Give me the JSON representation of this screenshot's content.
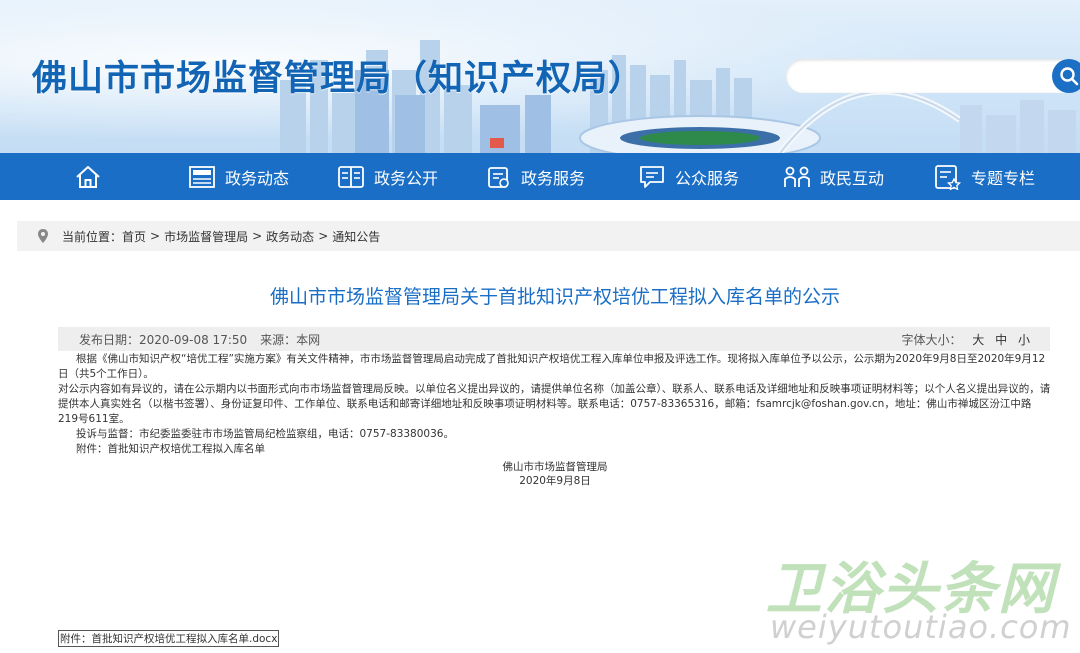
{
  "header": {
    "site_title": "佛山市市场监督管理局（知识产权局）",
    "search": {
      "value": "",
      "placeholder": ""
    }
  },
  "nav": {
    "home_icon": "home-icon",
    "items": [
      {
        "label": "政务动态",
        "icon": "news-icon"
      },
      {
        "label": "政务公开",
        "icon": "book-icon"
      },
      {
        "label": "政务服务",
        "icon": "service-icon"
      },
      {
        "label": "公众服务",
        "icon": "message-icon"
      },
      {
        "label": "政民互动",
        "icon": "people-icon"
      },
      {
        "label": "专题专栏",
        "icon": "topic-icon"
      }
    ]
  },
  "breadcrumb": {
    "prefix": "当前位置：",
    "items": [
      "首页",
      "市场监督管理局",
      "政务动态",
      "通知公告"
    ],
    "separator": ">"
  },
  "article": {
    "title": "佛山市市场监督管理局关于首批知识产权培优工程拟入库名单的公示",
    "publish_date": "发布日期：2020-09-08 17:50",
    "source": "来源：本网",
    "font_size_label": "字体大小：",
    "font_sizes": [
      "大",
      "中",
      "小"
    ],
    "paragraphs": [
      "根据《佛山市知识产权“培优工程”实施方案》有关文件精神，市市场监督管理局启动完成了首批知识产权培优工程入库单位申报及评选工作。现将拟入库单位予以公示，公示期为2020年9月8日至2020年9月12日（共5个工作日）。",
      "对公示内容如有异议的，请在公示期内以书面形式向市市场监督管理局反映。以单位名义提出异议的，请提供单位名称（加盖公章）、联系人、联系电话及详细地址和反映事项证明材料等；以个人名义提出异议的，请提供本人真实姓名（以楷书签署）、身份证复印件、工作单位、联系电话和邮寄详细地址和反映事项证明材料等。联系电话：0757-83365316，邮箱：fsamrcjk@foshan.gov.cn，地址：佛山市禅城区汾江中路219号611室。",
      "投诉与监督：市纪委监委驻市市场监管局纪检监察组，电话：0757-83380036。",
      "附件：首批知识产权培优工程拟入库名单"
    ],
    "signature_org": "佛山市市场监督管理局",
    "signature_date": "2020年9月8日",
    "attachment_link": "附件：首批知识产权培优工程拟入库名单.docx"
  },
  "watermark": {
    "cn": "卫浴头条网",
    "en": "weiyutoutiao.com"
  },
  "colors": {
    "nav_bg": "#1a6ec6",
    "title_blue": "#1264b4",
    "article_title": "#1a6ec6"
  }
}
